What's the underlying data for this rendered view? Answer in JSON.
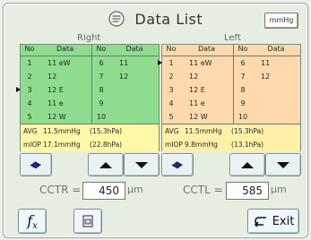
{
  "title": "Data List",
  "unit_button": "mmHg",
  "right": {
    "label": "Right",
    "col_left_header_no": "No",
    "col_left_header_data": "Data",
    "col_right_header_no": "No",
    "col_right_header_data": "Data",
    "rows_left": [
      {
        "no": "1",
        "data": "11 eW"
      },
      {
        "no": "2",
        "data": "12"
      },
      {
        "no": "3",
        "data": "12 E"
      },
      {
        "no": "4",
        "data": "11 e"
      },
      {
        "no": "5",
        "data": "12  W"
      }
    ],
    "rows_right": [
      {
        "no": "6",
        "data": "11"
      },
      {
        "no": "7",
        "data": "12"
      },
      {
        "no": "8",
        "data": ""
      },
      {
        "no": "9",
        "data": ""
      },
      {
        "no": "10",
        "data": ""
      }
    ],
    "avg_label": "AVG",
    "avg_value": "11.5mmHg",
    "avg_hpa": "(15.3hPa)",
    "iop_label": "mIOP",
    "iop_value": "17.1mmHg",
    "iop_hpa": "(22.8hPa)"
  },
  "left": {
    "label": "Left",
    "col_left_header_no": "No",
    "col_left_header_data": "Data",
    "col_right_header_no": "No",
    "col_right_header_data": "Data",
    "rows_left": [
      {
        "no": "1",
        "data": "11 eW"
      },
      {
        "no": "2",
        "data": "12"
      },
      {
        "no": "3",
        "data": "12 E"
      },
      {
        "no": "4",
        "data": "11 e"
      },
      {
        "no": "5",
        "data": "12  W"
      }
    ],
    "rows_right": [
      {
        "no": "6",
        "data": "11"
      },
      {
        "no": "7",
        "data": "12"
      },
      {
        "no": "8",
        "data": ""
      },
      {
        "no": "9",
        "data": ""
      },
      {
        "no": "10",
        "data": ""
      }
    ],
    "avg_label": "AVG",
    "avg_value": "11.5mmHg",
    "avg_hpa": "(15.3hPa)",
    "iop_label": "mIOP",
    "iop_value": "9.8mmHg",
    "iop_hpa": "(13.1hPa)"
  },
  "cct": {
    "right_label": "CCTR =",
    "right_value": "450",
    "left_label": "CCTL =",
    "left_value": "585",
    "unit": "μm"
  },
  "bottom": {
    "fx_label": "f",
    "exit_label": "Exit"
  }
}
